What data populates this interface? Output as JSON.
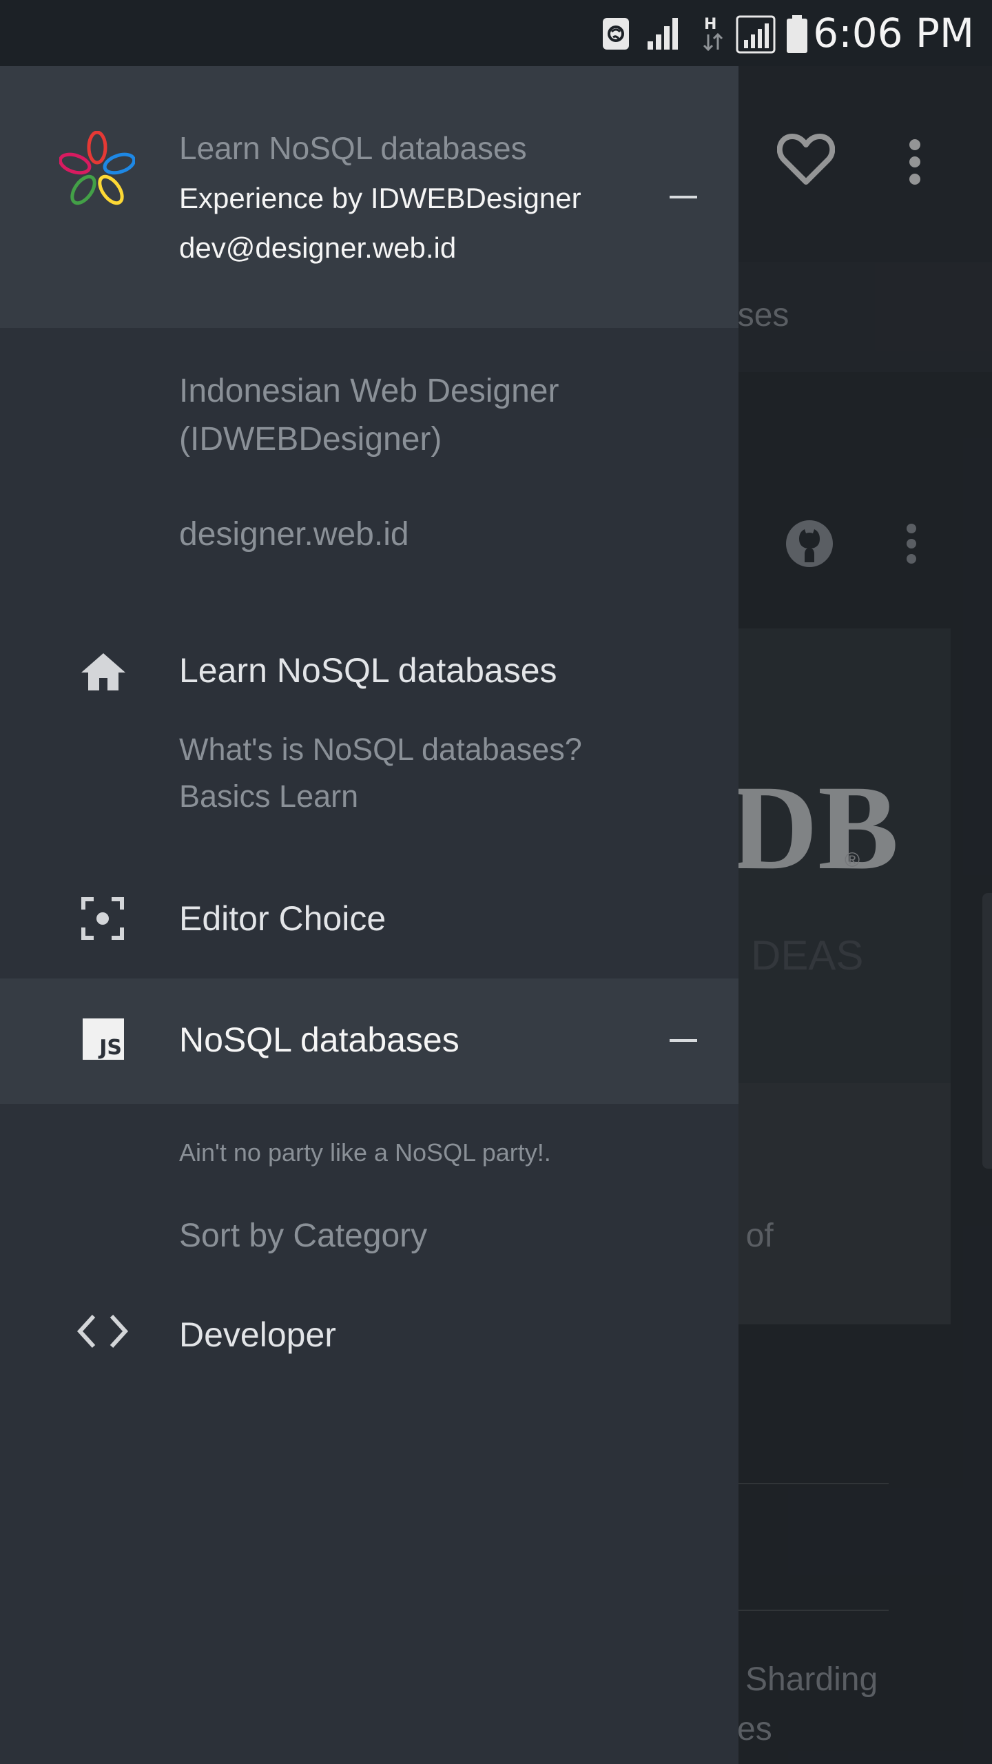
{
  "status_bar": {
    "time": "6:06 PM"
  },
  "drawer": {
    "header": {
      "app_title": "Learn NoSQL databases",
      "subtitle": "Experience by IDWEBDesigner",
      "email": "dev@designer.web.id"
    },
    "account": {
      "name_line1": "Indonesian Web Designer",
      "name_line2": "(IDWEBDesigner)",
      "website": "designer.web.id"
    },
    "items": [
      {
        "label": "Learn NoSQL databases",
        "icon": "home-icon"
      },
      {
        "label": "What's is NoSQL databases?"
      },
      {
        "label": "Basics Learn"
      },
      {
        "label": "Editor Choice",
        "icon": "center-focus-icon"
      },
      {
        "label": "NoSQL databases",
        "icon": "js-icon"
      },
      {
        "label": "Ain't no party like a NoSQL party!."
      },
      {
        "label": "Sort by Category"
      },
      {
        "label": "Developer",
        "icon": "code-icon"
      }
    ]
  },
  "background_app": {
    "subbar_fragment": "ases",
    "logo_fragment": "DB",
    "logo_registered": "®",
    "logo_tagline_fragment": "DEAS",
    "card_text_fragment": "t of",
    "list_fragment_1": "Sharding",
    "list_fragment_2": "es"
  },
  "colors": {
    "status_bar": "#1c2126",
    "drawer_bg": "#2c3139",
    "drawer_header_bg": "#363c44",
    "active_row_bg": "#363c44"
  }
}
